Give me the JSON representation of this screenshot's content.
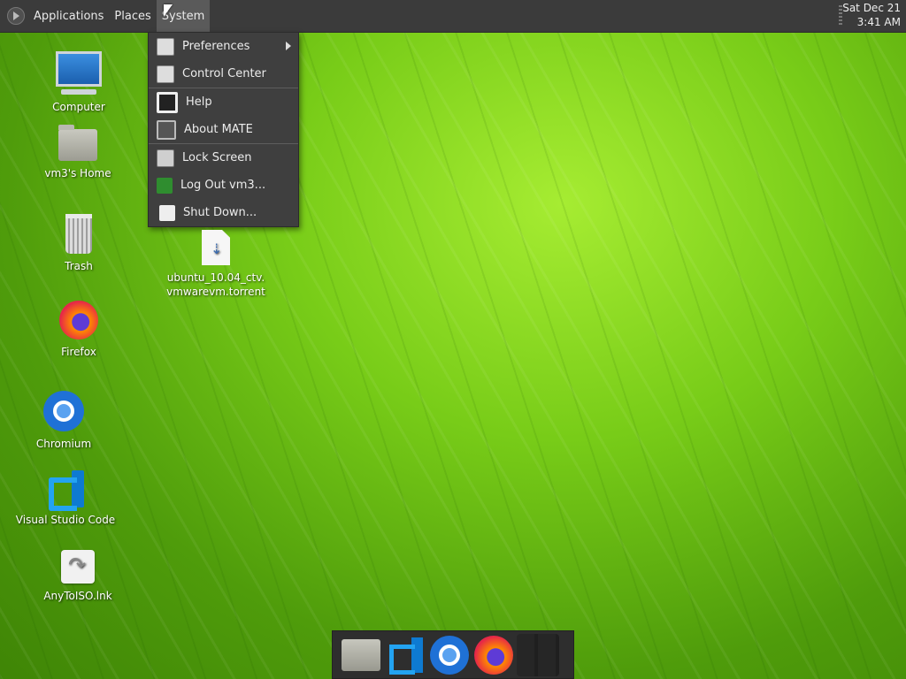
{
  "top_panel": {
    "menus": [
      "Applications",
      "Places",
      "System"
    ],
    "clock": {
      "date": "Sat Dec 21",
      "time": "3:41 AM"
    }
  },
  "system_menu": {
    "items": [
      {
        "label": "Preferences",
        "icon": "preferences-icon",
        "submenu": true
      },
      {
        "label": "Control Center",
        "icon": "control-center-icon"
      },
      {
        "label": "Help",
        "icon": "help-icon"
      },
      {
        "label": "About MATE",
        "icon": "about-mate-icon"
      },
      {
        "label": "Lock Screen",
        "icon": "lock-screen-icon"
      },
      {
        "label": "Log Out vm3...",
        "icon": "log-out-icon"
      },
      {
        "label": "Shut Down...",
        "icon": "shut-down-icon"
      }
    ]
  },
  "desktop_icons": {
    "computer": "Computer",
    "home": "vm3's Home",
    "trash": "Trash",
    "firefox": "Firefox",
    "chromium": "Chromium",
    "vscode": "Visual Studio Code",
    "anytoiso": "AnyToISO.lnk",
    "torrent_line1": "ubuntu_10.04_ctv.",
    "torrent_line2": "vmwarevm.torrent"
  },
  "dock": {
    "items": [
      "files-icon",
      "vscode-icon",
      "chromium-icon",
      "firefox-icon"
    ]
  },
  "colors": {
    "panel": "#3b3b3b",
    "menu_bg": "#3f3f3f",
    "wallpaper_green": "#78cc18"
  }
}
